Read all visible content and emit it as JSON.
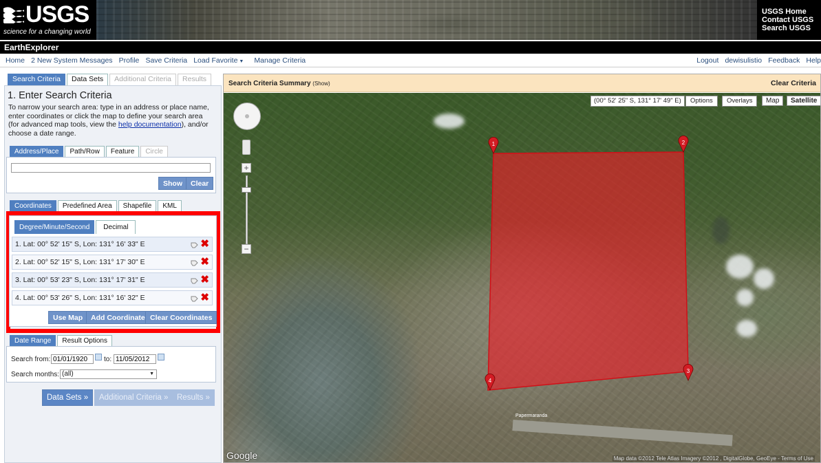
{
  "header": {
    "logo_text": "USGS",
    "logo_tagline": "science for a changing world",
    "links": [
      "USGS Home",
      "Contact USGS",
      "Search USGS"
    ]
  },
  "app_title": "EarthExplorer",
  "nav": {
    "left": [
      "Home",
      "2 New System Messages",
      "Profile",
      "Save Criteria",
      "Load Favorite",
      "Manage Criteria"
    ],
    "right": [
      "Logout",
      "dewisulistio",
      "Feedback",
      "Help"
    ]
  },
  "main_tabs": [
    {
      "label": "Search Criteria",
      "state": "active"
    },
    {
      "label": "Data Sets",
      "state": "normal"
    },
    {
      "label": "Additional Criteria",
      "state": "disabled"
    },
    {
      "label": "Results",
      "state": "disabled"
    }
  ],
  "search": {
    "heading": "1. Enter Search Criteria",
    "intro_before": "To narrow your search area: type in an address or place name, enter coordinates or click the map to define your search area (for advanced map tools, view the ",
    "intro_link": "help documentation",
    "intro_after": "), and/or choose a date range.",
    "address_tabs": [
      "Address/Place",
      "Path/Row",
      "Feature",
      "Circle"
    ],
    "address_value": "",
    "show_label": "Show",
    "clear_label": "Clear",
    "coord_tabs": [
      "Coordinates",
      "Predefined Area",
      "Shapefile",
      "KML"
    ],
    "format_tabs": [
      "Degree/Minute/Second",
      "Decimal"
    ],
    "coordinates": [
      "1.  Lat: 00° 52' 15\" S, Lon: 131° 16' 33\" E",
      "2.  Lat: 00° 52' 15\" S, Lon: 131° 17' 30\" E",
      "3.  Lat: 00° 53' 23\" S, Lon: 131° 17' 31\" E",
      "4.  Lat: 00° 53' 26\" S, Lon: 131° 16' 32\" E"
    ],
    "use_map_label": "Use Map",
    "add_coord_label": "Add Coordinate",
    "clear_coords_label": "Clear Coordinates",
    "date_tabs": [
      "Date Range",
      "Result Options"
    ],
    "search_from_label": "Search from:",
    "from_value": "01/01/1920",
    "to_label": "to:",
    "to_value": "11/05/2012",
    "months_label": "Search months:",
    "months_value": "(all)",
    "bottom_buttons": [
      "Data Sets »",
      "Additional Criteria »",
      "Results »"
    ]
  },
  "map": {
    "summary_title": "Search Criteria Summary",
    "summary_toggle": "(Show)",
    "clear_criteria": "Clear Criteria",
    "coord_readout": "(00° 52' 25\" S, 131° 17' 49\" E)",
    "options_label": "Options",
    "overlays_label": "Overlays",
    "map_type": [
      "Map",
      "Satellite"
    ],
    "place_label": "Papermaranda",
    "google_label": "Google",
    "attribution": "Map data ©2012 Tele Atlas Imagery ©2012 , DigitalGlobe, GeoEye - Terms of Use",
    "markers": [
      "1",
      "2",
      "3",
      "4"
    ],
    "polygon_color": "#e8202a"
  },
  "colors": {
    "accent": "#4f7fc0",
    "highlight_frame": "#ff0000",
    "summary_bar": "#fbe4bf"
  }
}
